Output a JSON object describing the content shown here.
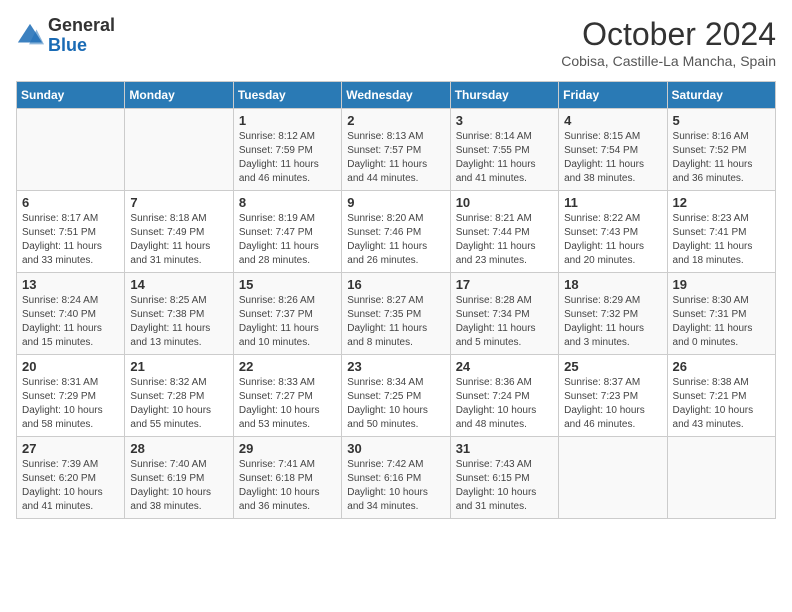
{
  "logo": {
    "general": "General",
    "blue": "Blue"
  },
  "title": "October 2024",
  "subtitle": "Cobisa, Castille-La Mancha, Spain",
  "headers": [
    "Sunday",
    "Monday",
    "Tuesday",
    "Wednesday",
    "Thursday",
    "Friday",
    "Saturday"
  ],
  "weeks": [
    [
      {
        "day": "",
        "info": ""
      },
      {
        "day": "",
        "info": ""
      },
      {
        "day": "1",
        "info": "Sunrise: 8:12 AM\nSunset: 7:59 PM\nDaylight: 11 hours and 46 minutes."
      },
      {
        "day": "2",
        "info": "Sunrise: 8:13 AM\nSunset: 7:57 PM\nDaylight: 11 hours and 44 minutes."
      },
      {
        "day": "3",
        "info": "Sunrise: 8:14 AM\nSunset: 7:55 PM\nDaylight: 11 hours and 41 minutes."
      },
      {
        "day": "4",
        "info": "Sunrise: 8:15 AM\nSunset: 7:54 PM\nDaylight: 11 hours and 38 minutes."
      },
      {
        "day": "5",
        "info": "Sunrise: 8:16 AM\nSunset: 7:52 PM\nDaylight: 11 hours and 36 minutes."
      }
    ],
    [
      {
        "day": "6",
        "info": "Sunrise: 8:17 AM\nSunset: 7:51 PM\nDaylight: 11 hours and 33 minutes."
      },
      {
        "day": "7",
        "info": "Sunrise: 8:18 AM\nSunset: 7:49 PM\nDaylight: 11 hours and 31 minutes."
      },
      {
        "day": "8",
        "info": "Sunrise: 8:19 AM\nSunset: 7:47 PM\nDaylight: 11 hours and 28 minutes."
      },
      {
        "day": "9",
        "info": "Sunrise: 8:20 AM\nSunset: 7:46 PM\nDaylight: 11 hours and 26 minutes."
      },
      {
        "day": "10",
        "info": "Sunrise: 8:21 AM\nSunset: 7:44 PM\nDaylight: 11 hours and 23 minutes."
      },
      {
        "day": "11",
        "info": "Sunrise: 8:22 AM\nSunset: 7:43 PM\nDaylight: 11 hours and 20 minutes."
      },
      {
        "day": "12",
        "info": "Sunrise: 8:23 AM\nSunset: 7:41 PM\nDaylight: 11 hours and 18 minutes."
      }
    ],
    [
      {
        "day": "13",
        "info": "Sunrise: 8:24 AM\nSunset: 7:40 PM\nDaylight: 11 hours and 15 minutes."
      },
      {
        "day": "14",
        "info": "Sunrise: 8:25 AM\nSunset: 7:38 PM\nDaylight: 11 hours and 13 minutes."
      },
      {
        "day": "15",
        "info": "Sunrise: 8:26 AM\nSunset: 7:37 PM\nDaylight: 11 hours and 10 minutes."
      },
      {
        "day": "16",
        "info": "Sunrise: 8:27 AM\nSunset: 7:35 PM\nDaylight: 11 hours and 8 minutes."
      },
      {
        "day": "17",
        "info": "Sunrise: 8:28 AM\nSunset: 7:34 PM\nDaylight: 11 hours and 5 minutes."
      },
      {
        "day": "18",
        "info": "Sunrise: 8:29 AM\nSunset: 7:32 PM\nDaylight: 11 hours and 3 minutes."
      },
      {
        "day": "19",
        "info": "Sunrise: 8:30 AM\nSunset: 7:31 PM\nDaylight: 11 hours and 0 minutes."
      }
    ],
    [
      {
        "day": "20",
        "info": "Sunrise: 8:31 AM\nSunset: 7:29 PM\nDaylight: 10 hours and 58 minutes."
      },
      {
        "day": "21",
        "info": "Sunrise: 8:32 AM\nSunset: 7:28 PM\nDaylight: 10 hours and 55 minutes."
      },
      {
        "day": "22",
        "info": "Sunrise: 8:33 AM\nSunset: 7:27 PM\nDaylight: 10 hours and 53 minutes."
      },
      {
        "day": "23",
        "info": "Sunrise: 8:34 AM\nSunset: 7:25 PM\nDaylight: 10 hours and 50 minutes."
      },
      {
        "day": "24",
        "info": "Sunrise: 8:36 AM\nSunset: 7:24 PM\nDaylight: 10 hours and 48 minutes."
      },
      {
        "day": "25",
        "info": "Sunrise: 8:37 AM\nSunset: 7:23 PM\nDaylight: 10 hours and 46 minutes."
      },
      {
        "day": "26",
        "info": "Sunrise: 8:38 AM\nSunset: 7:21 PM\nDaylight: 10 hours and 43 minutes."
      }
    ],
    [
      {
        "day": "27",
        "info": "Sunrise: 7:39 AM\nSunset: 6:20 PM\nDaylight: 10 hours and 41 minutes."
      },
      {
        "day": "28",
        "info": "Sunrise: 7:40 AM\nSunset: 6:19 PM\nDaylight: 10 hours and 38 minutes."
      },
      {
        "day": "29",
        "info": "Sunrise: 7:41 AM\nSunset: 6:18 PM\nDaylight: 10 hours and 36 minutes."
      },
      {
        "day": "30",
        "info": "Sunrise: 7:42 AM\nSunset: 6:16 PM\nDaylight: 10 hours and 34 minutes."
      },
      {
        "day": "31",
        "info": "Sunrise: 7:43 AM\nSunset: 6:15 PM\nDaylight: 10 hours and 31 minutes."
      },
      {
        "day": "",
        "info": ""
      },
      {
        "day": "",
        "info": ""
      }
    ]
  ]
}
